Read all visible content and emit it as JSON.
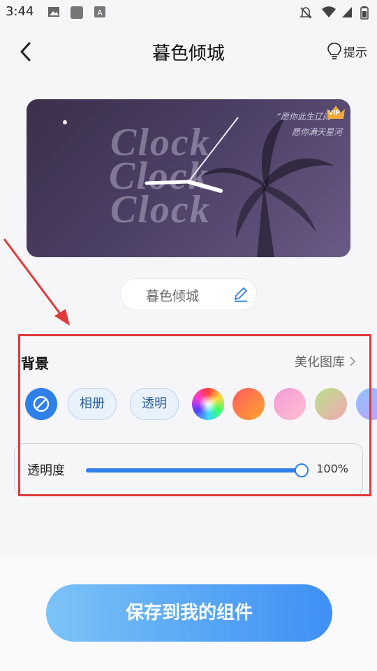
{
  "status_bar": {
    "time": "3:44"
  },
  "header": {
    "title": "暮色倾城",
    "hint_label": "提示"
  },
  "preview": {
    "words": [
      "Clock",
      "Clock",
      "Clock"
    ],
    "quote_line1": "“愿你此生辽阔",
    "quote_line2": "愿你满天星河",
    "vip_label": "VIP"
  },
  "widget_name": "暮色倾城",
  "background": {
    "label": "背景",
    "gallery_label": "美化图库",
    "chips": [
      "相册",
      "透明"
    ],
    "colors": {
      "accent": "#2f7fe8",
      "swatch_rainbow": "conic",
      "swatch_orange": "#ff6f4f",
      "swatch_pink": "#f6a7d6",
      "swatch_green": "#c8e095",
      "swatch_blue": "#9ab6ff"
    }
  },
  "opacity": {
    "label": "透明度",
    "value_text": "100%",
    "value": 1.0
  },
  "save_button_label": "保存到我的组件"
}
